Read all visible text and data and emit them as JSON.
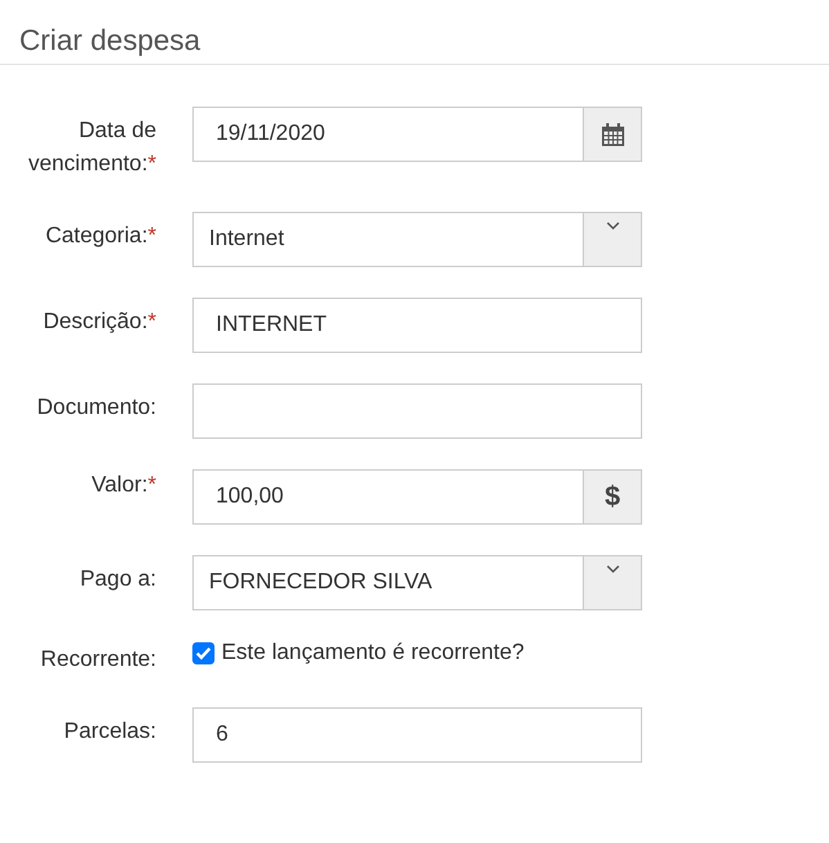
{
  "title": "Criar despesa",
  "fields": [
    {
      "kind": "date",
      "label": "Data de vencimento:",
      "required_mark": "*",
      "value": "19/11/2020"
    },
    {
      "kind": "select",
      "label": "Categoria:",
      "required_mark": "*",
      "value": "Internet"
    },
    {
      "kind": "text",
      "label": "Descrição:",
      "required_mark": "*",
      "value": "INTERNET"
    },
    {
      "kind": "text",
      "label": "Documento:"
    },
    {
      "kind": "currency",
      "label": "Valor:",
      "required_mark": "*",
      "value": "100,00",
      "addon": "$"
    },
    {
      "kind": "select",
      "label": "Pago a:",
      "value": "FORNECEDOR SILVA"
    },
    {
      "kind": "checkbox",
      "label": "Recorrente:",
      "text": "Este lançamento é recorrente?",
      "checked": true
    },
    {
      "kind": "text",
      "label": "Parcelas:",
      "value": "6"
    }
  ]
}
